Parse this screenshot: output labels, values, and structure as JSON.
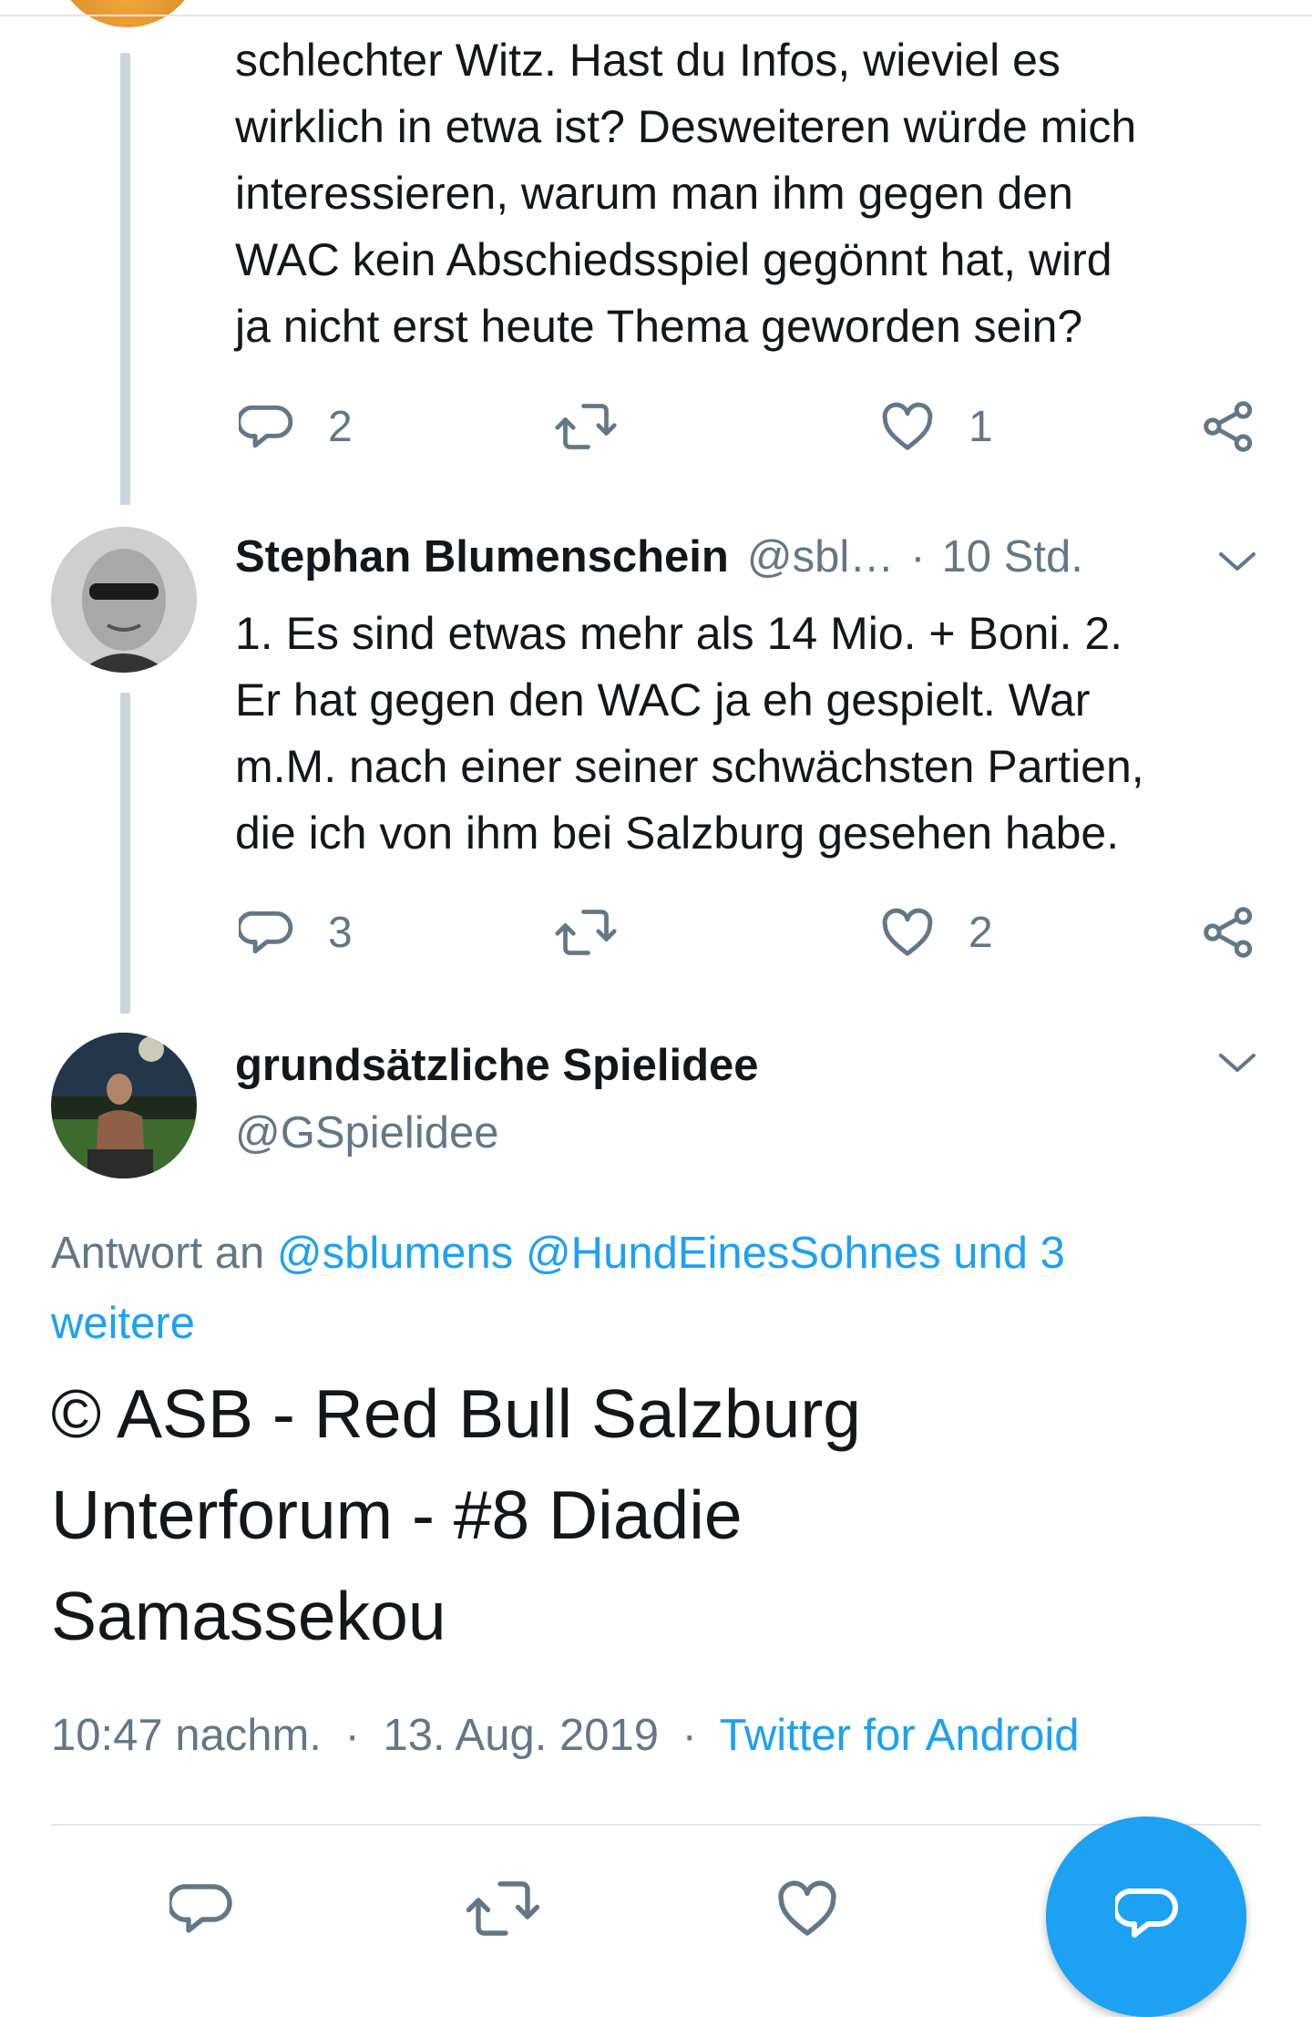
{
  "tweets": {
    "first": {
      "text_lines": [
        "schlechter Witz. Hast du Infos, wieviel es",
        "wirklich in etwa ist? Desweiteren würde mich",
        "interessieren, warum man ihm gegen den",
        "WAC kein Abschiedsspiel gegönnt hat, wird",
        "ja nicht erst heute Thema geworden sein?"
      ],
      "reply_count": "2",
      "like_count": "1"
    },
    "second": {
      "display_name": "Stephan Blumenschein",
      "handle": "@sbl…",
      "separator": "·",
      "time": "10 Std.",
      "text_lines": [
        "1. Es sind etwas mehr als 14 Mio. + Boni. 2.",
        "Er hat gegen den WAC ja eh gespielt. War",
        "m.M. nach einer seiner schwächsten Partien,",
        "die ich von ihm bei Salzburg gesehen habe."
      ],
      "reply_count": "3",
      "like_count": "2"
    },
    "focused": {
      "display_name": "grundsätzliche Spielidee",
      "handle": "@GSpielidee",
      "reply_to_prefix": "Antwort an",
      "reply_to_mention1": "@sblumens",
      "reply_to_mention2": "@HundEinesSohnes",
      "reply_to_more_line1": "und 3",
      "reply_to_more_line2": "weitere",
      "text_lines": [
        "© ASB - Red Bull Salzburg",
        "Unterforum - #8 Diadie",
        "Samassekou"
      ],
      "time": "10:47 nachm.",
      "sep1": "·",
      "date": "13. Aug. 2019",
      "sep2": "·",
      "source": "Twitter for Android"
    }
  },
  "icons": {
    "reply": "reply-icon",
    "retweet": "retweet-icon",
    "like": "heart-icon",
    "share": "share-icon",
    "chevron": "chevron-down-icon",
    "fab": "compose-reply-icon"
  },
  "colors": {
    "accent": "#1da1f2",
    "text": "#14171a",
    "secondary": "#657786",
    "thread_line": "#ccd6dd"
  }
}
